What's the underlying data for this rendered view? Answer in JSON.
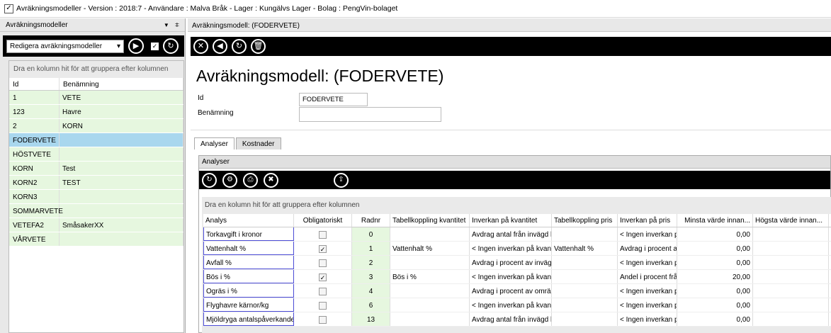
{
  "window": {
    "title": "Avräkningsmodeller - Version : 2018:7 - Användare : Malva Bråk - Lager : Kungälvs Lager - Bolag : PengVin-bolaget",
    "icon": "check-icon"
  },
  "left_panel": {
    "title": "Avräkningsmodeller",
    "controls": [
      "▼",
      "ⵐ"
    ],
    "select_value": "Redigera avräkningsmodeller",
    "group_hint": "Dra en kolumn hit för att gruppera efter kolumnen",
    "columns": [
      "Id",
      "Benämning"
    ],
    "rows": [
      {
        "id": "1",
        "name": "VETE"
      },
      {
        "id": "123",
        "name": "Havre"
      },
      {
        "id": "2",
        "name": "KORN"
      },
      {
        "id": "FODERVETE",
        "name": ""
      },
      {
        "id": "HÖSTVETE",
        "name": ""
      },
      {
        "id": "KORN",
        "name": "Test"
      },
      {
        "id": "KORN2",
        "name": "TEST"
      },
      {
        "id": "KORN3",
        "name": ""
      },
      {
        "id": "SOMMARVETE",
        "name": ""
      },
      {
        "id": "VETEFA2",
        "name": "SmåsakerXX"
      },
      {
        "id": "VÅRVETE",
        "name": ""
      }
    ],
    "selected_row": 3
  },
  "right_panel": {
    "header": "Avräkningsmodell:  (FODERVETE)",
    "form_title": "Avräkningsmodell:  (FODERVETE)",
    "id_label": "Id",
    "id_value": "FODERVETE",
    "name_label": "Benämning",
    "name_value": "",
    "tabs": [
      "Analyser",
      "Kostnader"
    ],
    "active_tab": "Analyser"
  },
  "analyser": {
    "title": "Analyser",
    "group_hint": "Dra en kolumn hit för att gruppera efter kolumnen",
    "columns": [
      "Analys",
      "Obligatoriskt",
      "Radnr",
      "Tabellkoppling kvantitet",
      "Inverkan på kvantitet",
      "Tabellkoppling pris",
      "Inverkan på pris",
      "Minsta värde innan...",
      "Högsta värde innan..."
    ],
    "rows": [
      {
        "analys": "Torkavgift i kronor",
        "obl": false,
        "radnr": "0",
        "tk": "",
        "ik": "Avdrag antal från invägd k",
        "tp": "",
        "ip": "< Ingen inverkan p",
        "min": "0,00",
        "max": ""
      },
      {
        "analys": "Vattenhalt %",
        "obl": true,
        "radnr": "1",
        "tk": "Vattenhalt %",
        "ik": "< Ingen inverkan på kvant",
        "tp": "Vattenhalt %",
        "ip": "Avdrag i procent av",
        "min": "0,00",
        "max": ""
      },
      {
        "analys": "Avfall %",
        "obl": false,
        "radnr": "2",
        "tk": "",
        "ik": "Avdrag i procent av inväg",
        "tp": "",
        "ip": "< Ingen inverkan p",
        "min": "0,00",
        "max": ""
      },
      {
        "analys": "Bös i %",
        "obl": true,
        "radnr": "3",
        "tk": "Bös i %",
        "ik": "< Ingen inverkan på kvant",
        "tp": "",
        "ip": "Andel i procent frå",
        "min": "20,00",
        "max": ""
      },
      {
        "analys": "Ogräs i %",
        "obl": false,
        "radnr": "4",
        "tk": "",
        "ik": "Avdrag i procent av omräl",
        "tp": "",
        "ip": "< Ingen inverkan p",
        "min": "0,00",
        "max": ""
      },
      {
        "analys": "Flyghavre kärnor/kg",
        "obl": false,
        "radnr": "6",
        "tk": "",
        "ik": "< Ingen inverkan på kvant",
        "tp": "",
        "ip": "< Ingen inverkan p",
        "min": "0,00",
        "max": ""
      },
      {
        "analys": "Mjöldryga antalspåverkande",
        "obl": false,
        "radnr": "13",
        "tk": "",
        "ik": "Avdrag antal från invägd k",
        "tp": "",
        "ip": "< Ingen inverkan p",
        "min": "0,00",
        "max": ""
      }
    ]
  },
  "icons": {
    "play": "▶",
    "check": "✓",
    "refresh": "↻",
    "close": "✕",
    "back": "◀",
    "delete": "🗑",
    "settings": "⚙",
    "print": "⎙",
    "excel": "✖",
    "export": "⇪",
    "dropdown": "▾"
  }
}
